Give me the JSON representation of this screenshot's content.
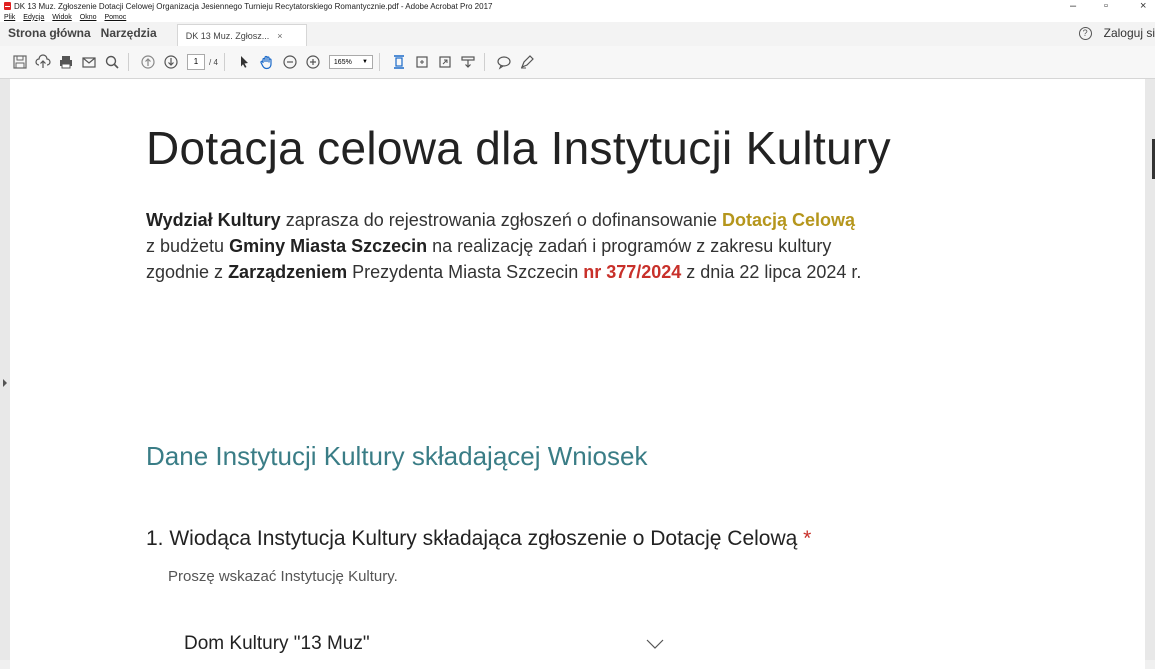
{
  "window": {
    "title": "DK 13 Muz. Zgłoszenie Dotacji Celowej Organizacja Jesiennego Turnieju Recytatorskiego Romantycznie.pdf - Adobe Acrobat Pro 2017",
    "controls": [
      "–",
      "▫",
      "×"
    ]
  },
  "menu": [
    "Plik",
    "Edycja",
    "Widok",
    "Okno",
    "Pomoc"
  ],
  "tabs": {
    "home": "Strona główna",
    "tools": "Narzędzia",
    "document": "DK 13 Muz. Zgłosz...",
    "close": "×",
    "login": "Zaloguj si"
  },
  "toolbar": {
    "page_current": "1",
    "page_total": "/ 4",
    "zoom": "165%"
  },
  "document": {
    "heading": "Dotacja celowa dla Instytucji Kultury",
    "intro": {
      "p1_bold": "Wydział Kultury",
      "p1_text": " zaprasza do rejestrowania zgłoszeń o dofinansowanie ",
      "p1_gold": "Dotacją Celową",
      "p2_text_a": "z budżetu ",
      "p2_bold": "Gminy Miasta Szczecin",
      "p2_text_b": " na realizację zadań i programów z zakresu kultury",
      "p3_text_a": "zgodnie z ",
      "p3_bold": "Zarządzeniem",
      "p3_text_b": " Prezydenta Miasta Szczecin ",
      "p3_red": "nr 377/2024",
      "p3_text_c": " z dnia 22 lipca 2024 r."
    },
    "section_title": "Dane Instytucji Kultury składającej Wniosek",
    "question": "1. Wiodąca Instytucja Kultury składająca zgłoszenie o Dotację Celową",
    "required_mark": "*",
    "hint": "Proszę wskazać Instytucję Kultury.",
    "selected_value": "Dom Kultury \"13 Muz\""
  },
  "colors": {
    "accent_gold": "#b5961c",
    "accent_red": "#c8302a",
    "section_teal": "#3a7d86"
  }
}
